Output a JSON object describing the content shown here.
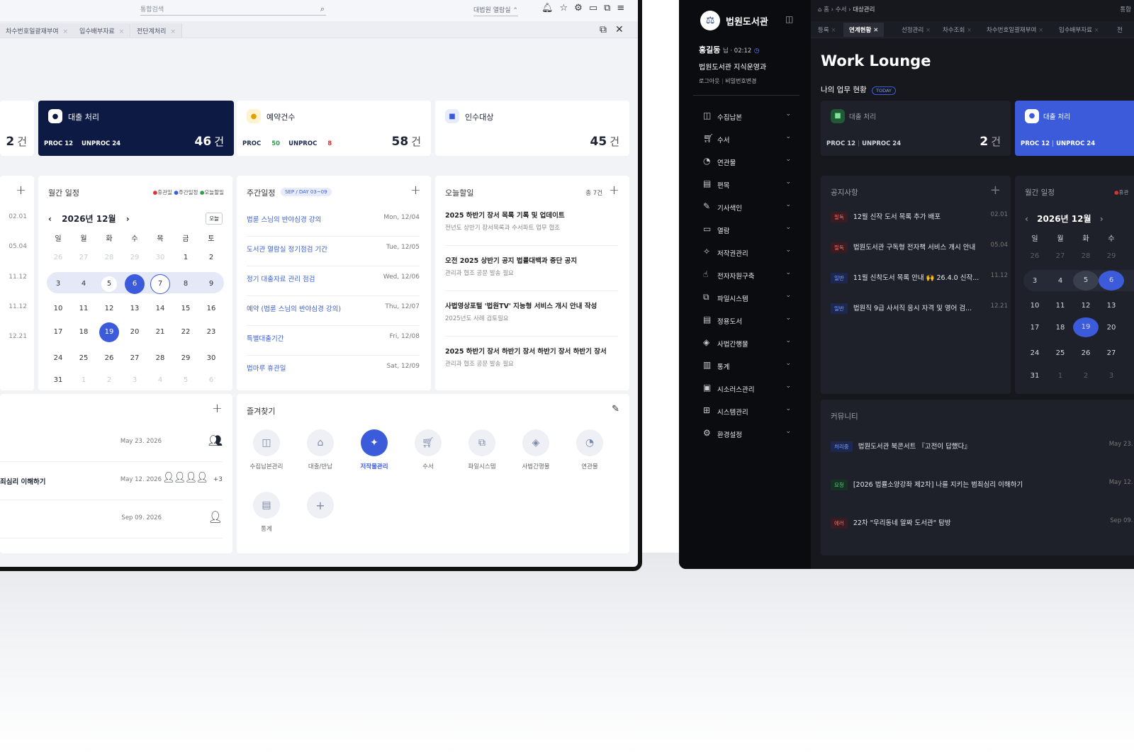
{
  "light": {
    "search_placeholder": "통합검색",
    "library_select": "대법원 열람실",
    "tabs": [
      "차수번호일괄재부여",
      "입수배부자료",
      "전단계처리"
    ],
    "stats": [
      {
        "label": "대출 처리",
        "proc": "PROC 12",
        "unproc": "UNPROC 24",
        "count": "46",
        "unit": "건"
      },
      {
        "label": "예약건수",
        "proc_label": "PROC",
        "proc_val": "50",
        "unproc_label": "UNPROC",
        "unproc_val": "8",
        "count": "58",
        "unit": "건"
      },
      {
        "label": "인수대상",
        "count": "45",
        "unit": "건"
      }
    ],
    "partial_count": "2",
    "partial_unit": "건",
    "left_dates": [
      "02.01",
      "05.04",
      "11.12",
      "11.12",
      "12.21"
    ],
    "monthly": {
      "title": "월간 일정",
      "legend": [
        "휴관일",
        "주간일정",
        "오늘할일"
      ],
      "month": "2026년 12월",
      "today_btn": "오늘",
      "weekdays": [
        "일",
        "월",
        "화",
        "수",
        "목",
        "금",
        "토"
      ],
      "rows": [
        [
          "26",
          "27",
          "28",
          "29",
          "30",
          "1",
          "2"
        ],
        [
          "3",
          "4",
          "5",
          "6",
          "7",
          "8",
          "9"
        ],
        [
          "10",
          "11",
          "12",
          "13",
          "14",
          "15",
          "16"
        ],
        [
          "17",
          "18",
          "19",
          "20",
          "21",
          "22",
          "23"
        ],
        [
          "24",
          "25",
          "26",
          "27",
          "28",
          "29",
          "30"
        ],
        [
          "31",
          "1",
          "2",
          "3",
          "4",
          "5",
          "6"
        ]
      ]
    },
    "weekly": {
      "title": "주간일정",
      "badge": "SEP / DAY 03~09",
      "items": [
        {
          "t": "법륜 스님의 반야심경 강의",
          "d": "Mon, 12/04"
        },
        {
          "t": "도서관 열람실 정기점검 기간",
          "d": "Tue, 12/05"
        },
        {
          "t": "정기 대출자료 관리 점검",
          "d": "Wed, 12/06"
        },
        {
          "t": "예약 (법륜 스님의 반야심경 강의)",
          "d": "Thu, 12/07"
        },
        {
          "t": "특별대출기간",
          "d": "Fri, 12/08"
        },
        {
          "t": "법마루 휴관일",
          "d": "Sat, 12/09"
        }
      ]
    },
    "todo": {
      "title": "오늘할일",
      "total": "총 7건",
      "items": [
        {
          "t": "2025 하반기 장서 목록 기록 및 업데이트",
          "s": "전년도 상반기 장서목록과 수서파트 업무 협조"
        },
        {
          "t": "오전 2025 상반기 공지 법률대백과 중단 공지",
          "s": "관리과 협조 공문 발송 필요"
        },
        {
          "t": "사법영상포털 '법원TV' 지능형 서비스 개시 안내 작성",
          "s": "2025년도 사례 검토필요"
        },
        {
          "t": "2025 하반기 장서 하반기 장서 하반기 장서 하반기 장서",
          "s": "관리과 협조 공문 발송 필요"
        }
      ]
    },
    "community": [
      {
        "t": "",
        "d": "May 23. 2026"
      },
      {
        "t": "죄심리 이해하기",
        "d": "May 12. 2026",
        "more": "+3"
      },
      {
        "t": "",
        "d": "Sep 09. 2026"
      }
    ],
    "favorites": {
      "title": "즐겨찾기",
      "items": [
        "수집납본관리",
        "대출/반납",
        "저작물관리",
        "수서",
        "파일시스템",
        "사법간행물",
        "연관물",
        "통계"
      ]
    }
  },
  "dark": {
    "app_name": "법원도서관",
    "user_name": "홍길동",
    "user_suffix": "님 · 02:12",
    "dept": "법원도서관 지식운영과",
    "logout": "로그아웃",
    "change_pw": "비밀번호변경",
    "menu": [
      "수집납본",
      "수서",
      "연관물",
      "편목",
      "기사색인",
      "열람",
      "저작권관리",
      "전자자원구축",
      "파일시스템",
      "정용도서",
      "사법간행물",
      "통계",
      "시소러스관리",
      "시스템관리",
      "환경설정"
    ],
    "breadcrumb": [
      "홈",
      "수서",
      "대상관리"
    ],
    "breadcrumb_right": "통합",
    "tabs": [
      "등록",
      "연계현황",
      "선정관리",
      "차수조회",
      "차수번호일괄재부여",
      "입수배부자료",
      "전"
    ],
    "page_title": "Work Lounge",
    "status_title": "나의 업무 현황",
    "today_badge": "TODAY",
    "stats": [
      {
        "label": "대출 처리",
        "proc": "PROC 12",
        "unproc": "UNPROC 24",
        "count": "2",
        "unit": "건"
      },
      {
        "label": "대출 처리",
        "proc": "PROC 12",
        "unproc": "UNPROC 24"
      }
    ],
    "notice": {
      "title": "공지사항",
      "items": [
        {
          "b": "필독",
          "t": "12월 신작 도서 목록 추가 배포",
          "d": "02.01"
        },
        {
          "b": "필독",
          "t": "법원도서관 구독형 전자책 서비스 개시 안내",
          "d": "05.04"
        },
        {
          "b": "일반",
          "t": "11월 신착도서 목록 안내 🙌 26.4.0 신작...",
          "d": "11.12"
        },
        {
          "b": "일반",
          "t": "법원직 9급 사서직 응시 자격 및 영어 검...",
          "d": "12.21"
        }
      ]
    },
    "monthly": {
      "title": "월간 일정",
      "legend": "휴관",
      "month": "2026년 12월",
      "weekdays": [
        "일",
        "월",
        "화",
        "수"
      ],
      "rows": [
        [
          "26",
          "27",
          "28",
          "29"
        ],
        [
          "3",
          "4",
          "5",
          "6"
        ],
        [
          "10",
          "11",
          "12",
          "13"
        ],
        [
          "17",
          "18",
          "19",
          "20"
        ],
        [
          "24",
          "25",
          "26",
          "27"
        ],
        [
          "31",
          "1",
          "2",
          "3"
        ]
      ]
    },
    "community": {
      "title": "커뮤니티",
      "items": [
        {
          "b": "처리중",
          "t": "법원도서관 북콘서트 『고전이 답했다』",
          "d": "May 23. 20"
        },
        {
          "b": "요청",
          "t": "[2026 법률소양강좌 제2차] 나를 지키는 범죄심리 이해하기",
          "d": "May 12. 20"
        },
        {
          "b": "에러",
          "t": "22차 \"우리동네 알짜 도서관\" 탐방",
          "d": "Sep 09. 20"
        }
      ]
    }
  },
  "colors": {
    "accent": "#3b5bdb",
    "navy": "#0c1a44",
    "dark_bg": "#16181e"
  }
}
